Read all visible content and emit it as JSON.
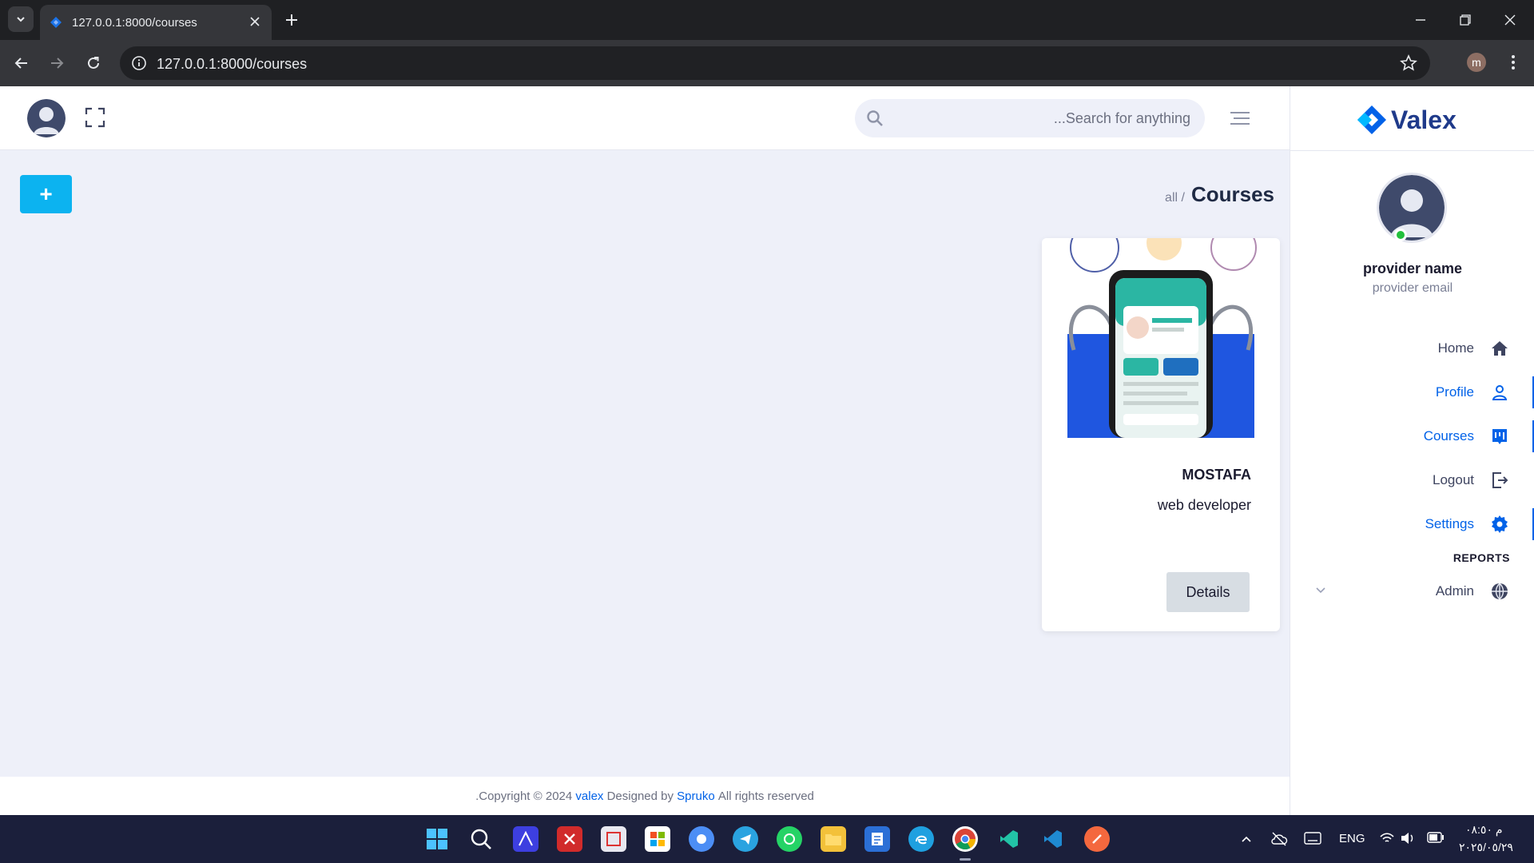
{
  "browser": {
    "tab_title": "127.0.0.1:8000/courses",
    "url": "127.0.0.1:8000/courses",
    "profile_initial": "m"
  },
  "header": {
    "search_placeholder": "...Search for anything"
  },
  "page": {
    "add_label": "+",
    "breadcrumb_parent": "all /",
    "title": "Courses"
  },
  "course_card": {
    "name": "MOSTAFA",
    "role": "web developer",
    "details_label": "Details"
  },
  "sidebar": {
    "brand": "Valex",
    "user_name": "provider name",
    "user_email": "provider email",
    "items": [
      {
        "label": "Home",
        "icon": "home-icon",
        "active": false
      },
      {
        "label": "Profile",
        "icon": "user-icon",
        "active": true
      },
      {
        "label": "Courses",
        "icon": "courses-icon",
        "active": true
      },
      {
        "label": "Logout",
        "icon": "logout-icon",
        "active": false
      },
      {
        "label": "Settings",
        "icon": "gear-icon",
        "active": true
      }
    ],
    "category": "REPORTS",
    "admin_label": "Admin"
  },
  "footer": {
    "copyright": ".Copyright © 2024",
    "brand": "valex",
    "designed": "Designed by",
    "designer": "Spruko",
    "rights": "All rights reserved"
  },
  "taskbar": {
    "lang": "ENG",
    "time": "م ٠٨:٥٠",
    "date": "٢٠٢٥/٠٥/٢٩"
  },
  "colors": {
    "accent": "#0162e8",
    "add_button": "#0cb3f0",
    "page_bg": "#eef0f9"
  }
}
